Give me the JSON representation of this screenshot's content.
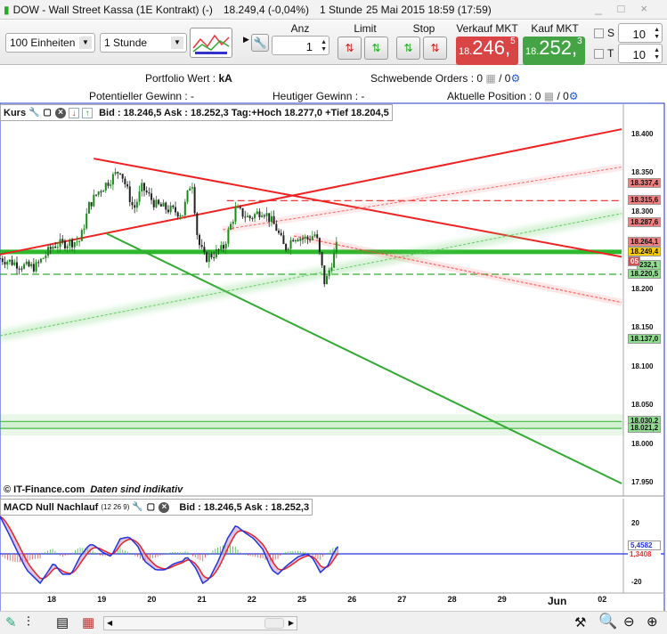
{
  "title": {
    "instrument": "DOW - Wall Street Kassa (1E Kontrakt) (-)",
    "quote": "18.249,4 (-0,04%)",
    "interval": "1 Stunde",
    "datetime": "25 Mai 2015 18:59 (17:59)"
  },
  "toolbar": {
    "units": "100 Einheiten",
    "period": "1 Stunde",
    "anz_label": "Anz",
    "anz_value": "1",
    "limit_label": "Limit",
    "stop_label": "Stop",
    "sell_label": "Verkauf MKT",
    "sell_prefix": "18.",
    "sell_main": "246,",
    "sell_sup": "5",
    "buy_label": "Kauf MKT",
    "buy_prefix": "18.",
    "buy_main": "252,",
    "buy_sup": "3",
    "s_label": "S",
    "t_label": "T",
    "s_value": "10",
    "t_value": "10"
  },
  "info": {
    "portfolio": "Portfolio Wert :",
    "portfolio_val": "kA",
    "pending": "Schwebende Orders : 0",
    "pending2": "/ 0",
    "potential": "Potentieller Gewinn : -",
    "today": "Heutiger Gewinn : -",
    "position": "Aktuelle Position : 0",
    "position2": "/ 0"
  },
  "kurs_panel": {
    "title": "Kurs",
    "quote": "Bid : 18.246,5 Ask : 18.252,3 Tag:+Hoch 18.277,0 +Tief 18.204,5",
    "footer": "© IT-Finance.com",
    "footer2": "Daten sind indikativ"
  },
  "macd_panel": {
    "title": "MACD Null Nachlauf",
    "params": "(12 26 9)",
    "quote": "Bid : 18.246,5 Ask : 18.252,3"
  },
  "colors": {
    "up": "#1a8a1a",
    "down": "#222222",
    "red": "#ee2222",
    "green": "#33bb33",
    "sell": "#d94444",
    "buy": "#44a344"
  },
  "chart_data": {
    "type": "candlestick",
    "price_axis": {
      "ticks": [
        "18.400",
        "18.350",
        "18.300",
        "18.250",
        "18.200",
        "18.150",
        "18.100",
        "18.050",
        "18.000",
        "17.950"
      ],
      "values": [
        18400,
        18350,
        18300,
        18250,
        18200,
        18150,
        18100,
        18050,
        18000,
        17950
      ],
      "range": [
        17950,
        18400
      ]
    },
    "date_axis": {
      "labels": [
        "18",
        "19",
        "20",
        "21",
        "22",
        "25",
        "26",
        "27",
        "28",
        "29",
        "Jun",
        "02"
      ],
      "day_index": [
        0,
        1,
        2,
        3,
        4,
        5,
        6,
        7,
        8,
        9,
        10,
        11
      ]
    },
    "close_path": [
      [
        -1.03,
        18241
      ],
      [
        -0.5,
        18230
      ],
      [
        -0.32,
        18230
      ],
      [
        0.04,
        18258
      ],
      [
        0.57,
        18264
      ],
      [
        0.75,
        18310
      ],
      [
        0.93,
        18327
      ],
      [
        1.37,
        18356
      ],
      [
        1.64,
        18304
      ],
      [
        1.81,
        18333
      ],
      [
        2.08,
        18310
      ],
      [
        2.35,
        18304
      ],
      [
        2.62,
        18299
      ],
      [
        2.8,
        18345
      ],
      [
        2.92,
        18264
      ],
      [
        3.06,
        18241
      ],
      [
        3.42,
        18253
      ],
      [
        3.68,
        18304
      ],
      [
        3.95,
        18293
      ],
      [
        4.22,
        18304
      ],
      [
        4.48,
        18281
      ],
      [
        4.66,
        18253
      ],
      [
        4.84,
        18270
      ],
      [
        5.11,
        18266
      ],
      [
        5.28,
        18273
      ],
      [
        5.46,
        18207
      ],
      [
        5.59,
        18235
      ],
      [
        5.73,
        18264
      ]
    ],
    "trendlines": [
      {
        "name": "red-rising-trendline",
        "color": "#ee2222",
        "from": [
          -1.03,
          18246
        ],
        "to": [
          11.39,
          18408
        ],
        "style": "solid"
      },
      {
        "name": "red-falling-trendline",
        "color": "#ee2222",
        "from": [
          0.84,
          18370
        ],
        "to": [
          11.39,
          18243
        ],
        "style": "solid"
      },
      {
        "name": "green-falling-trendline",
        "color": "#33aa33",
        "from": [
          1.1,
          18273
        ],
        "to": [
          11.39,
          17950
        ],
        "style": "solid"
      },
      {
        "name": "green-channel-line",
        "color": "#66cc66",
        "from": [
          -1.03,
          18141
        ],
        "to": [
          11.39,
          18299
        ],
        "style": "glow"
      },
      {
        "name": "red-channel-line",
        "color": "#ff6666",
        "from": [
          3.42,
          18278
        ],
        "to": [
          11.39,
          18359
        ],
        "style": "dotted"
      },
      {
        "name": "red-dotted-falling-line",
        "color": "#ff4444",
        "from": [
          4.84,
          18270
        ],
        "to": [
          11.39,
          18184
        ],
        "style": "dotted"
      }
    ],
    "levels": [
      {
        "name": "red-dashed-level",
        "price": 18315.6,
        "color": "#ee2222",
        "style": "dashed",
        "from": 3.5
      },
      {
        "name": "current-price-level",
        "price": 18249.4,
        "color": "#2db82d",
        "style": "thick",
        "from": -1.03
      },
      {
        "name": "green-dashed-level",
        "price": 18220.5,
        "color": "#33aa33",
        "style": "dashed",
        "from": -1.03
      },
      {
        "name": "green-level-1",
        "price": 18030.2,
        "color": "#44bb44",
        "style": "glow",
        "from": -1.03
      },
      {
        "name": "green-level-2",
        "price": 18021.2,
        "color": "#44bb44",
        "style": "glow",
        "from": -1.03
      }
    ],
    "price_tags": [
      {
        "text": "18.337,4",
        "price": 18337.4,
        "kind": "red"
      },
      {
        "text": "18.315,6",
        "price": 18315.6,
        "kind": "red"
      },
      {
        "text": "18.287,6",
        "price": 18287.6,
        "kind": "red"
      },
      {
        "text": "18.264,1",
        "price": 18262,
        "kind": "red"
      },
      {
        "text": "18.249,4",
        "price": 18249.4,
        "kind": "yellow"
      },
      {
        "text": "232,1",
        "price": 18232.1,
        "kind": "green"
      },
      {
        "text": "05",
        "price": 18236,
        "kind": "redsmall"
      },
      {
        "text": "18.220,5",
        "price": 18220.5,
        "kind": "green"
      },
      {
        "text": "18.137,0",
        "price": 18137,
        "kind": "green"
      },
      {
        "text": "18.030,2",
        "price": 18030.2,
        "kind": "green"
      },
      {
        "text": "18.021,2",
        "price": 18021.2,
        "kind": "green"
      }
    ],
    "macd": {
      "axis_ticks": [
        "20",
        "-20"
      ],
      "axis_values": [
        20,
        -20
      ],
      "tag_macd": "5,4582",
      "tag_signal": "1,3408",
      "points": [
        [
          -1.03,
          25.5
        ],
        [
          -0.85,
          13.3
        ],
        [
          -0.68,
          1.2
        ],
        [
          -0.5,
          -10.9
        ],
        [
          -0.23,
          -20
        ],
        [
          -0.05,
          -10.9
        ],
        [
          0.04,
          -6.1
        ],
        [
          0.21,
          -13.9
        ],
        [
          0.39,
          -13.9
        ],
        [
          0.57,
          -1.8
        ],
        [
          0.75,
          6.1
        ],
        [
          0.84,
          6.1
        ],
        [
          1.01,
          1.2
        ],
        [
          1.19,
          -1.8
        ],
        [
          1.37,
          10.3
        ],
        [
          1.55,
          11.5
        ],
        [
          1.73,
          4.8
        ],
        [
          1.85,
          -4.8
        ],
        [
          2.08,
          -10.9
        ],
        [
          2.26,
          -10.9
        ],
        [
          2.44,
          -6.7
        ],
        [
          2.62,
          -4.8
        ],
        [
          2.7,
          -1.8
        ],
        [
          2.88,
          -9.7
        ],
        [
          3.02,
          -20
        ],
        [
          3.15,
          -17
        ],
        [
          3.33,
          -4.8
        ],
        [
          3.51,
          10.3
        ],
        [
          3.68,
          19.4
        ],
        [
          3.86,
          14.5
        ],
        [
          4.04,
          10.3
        ],
        [
          4.22,
          3
        ],
        [
          4.4,
          -10.9
        ],
        [
          4.52,
          -13.9
        ],
        [
          4.7,
          -7.9
        ],
        [
          4.93,
          -1.8
        ],
        [
          5.11,
          0
        ],
        [
          5.23,
          -3.6
        ],
        [
          5.37,
          -12.7
        ],
        [
          5.52,
          -7.9
        ],
        [
          5.64,
          1.2
        ],
        [
          5.73,
          5.5
        ]
      ]
    }
  }
}
